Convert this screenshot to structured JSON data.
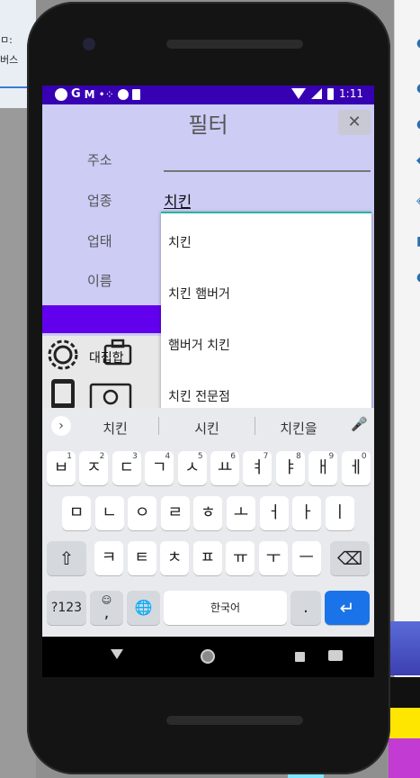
{
  "desktop": {
    "left_text_1": "ㅁ:",
    "left_text_2": "버스"
  },
  "status_bar": {
    "time": "1:11",
    "app_icons": [
      "circle-icon",
      "google-icon",
      "gmail-icon",
      "dots-icon",
      "circle-icon",
      "sdcard-icon"
    ],
    "system_icons": [
      "wifi-icon",
      "signal-icon",
      "battery-icon"
    ]
  },
  "dialog": {
    "title": "필터",
    "close_label": "✕",
    "fields": {
      "address_label": "주소",
      "address_value": "",
      "industry_label": "업종",
      "industry_value": "치킨",
      "business_label": "업태",
      "name_label": "이름"
    },
    "category_label": "대집합"
  },
  "autocomplete": {
    "items": [
      "치킨",
      "치킨 햄버거",
      "햄버거 치킨",
      "치킨 전문점"
    ]
  },
  "keyboard": {
    "suggestions": [
      "치킨",
      "시킨",
      "치킨을"
    ],
    "row1": [
      {
        "label": "ㅂ",
        "num": "1"
      },
      {
        "label": "ㅈ",
        "num": "2"
      },
      {
        "label": "ㄷ",
        "num": "3"
      },
      {
        "label": "ㄱ",
        "num": "4"
      },
      {
        "label": "ㅅ",
        "num": "5"
      },
      {
        "label": "ㅛ",
        "num": "6"
      },
      {
        "label": "ㅕ",
        "num": "7"
      },
      {
        "label": "ㅑ",
        "num": "8"
      },
      {
        "label": "ㅐ",
        "num": "9"
      },
      {
        "label": "ㅔ",
        "num": "0"
      }
    ],
    "row2": [
      "ㅁ",
      "ㄴ",
      "ㅇ",
      "ㄹ",
      "ㅎ",
      "ㅗ",
      "ㅓ",
      "ㅏ",
      "ㅣ"
    ],
    "row3": [
      "ㅋ",
      "ㅌ",
      "ㅊ",
      "ㅍ",
      "ㅠ",
      "ㅜ",
      "ㅡ"
    ],
    "shift_label": "⇧",
    "backspace_label": "⌫",
    "symbols_label": "?123",
    "emoji_comma_label": ",",
    "globe_label": "🌐",
    "space_label": "한국어",
    "period_label": ".",
    "enter_label": "↵"
  },
  "colors": {
    "status_bar": "#3700b3",
    "accent": "#6200ee",
    "screen_bg": "#ccccf5",
    "keyboard_enter": "#1a73e8"
  }
}
